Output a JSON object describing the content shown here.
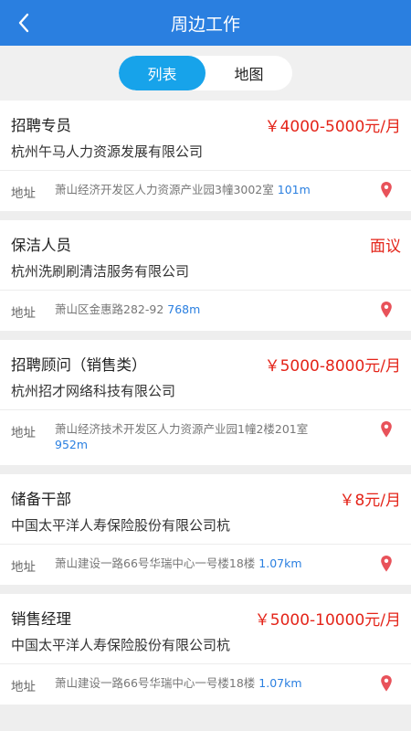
{
  "header": {
    "title": "周边工作",
    "back_icon": "chevron-left-icon"
  },
  "tabs": [
    {
      "label": "列表",
      "active": true
    },
    {
      "label": "地图",
      "active": false
    }
  ],
  "address_label": "地址",
  "jobs": [
    {
      "title": "招聘专员",
      "salary": "￥4000-5000元/月",
      "company": "杭州午马人力资源发展有限公司",
      "address": "萧山经济开发区人力资源产业园3幢3002室",
      "distance": "101m"
    },
    {
      "title": "保洁人员",
      "salary": "面议",
      "company": "杭州洗刷刷清洁服务有限公司",
      "address": "萧山区金惠路282-92",
      "distance": "768m"
    },
    {
      "title": "招聘顾问（销售类）",
      "salary": "￥5000-8000元/月",
      "company": "杭州招才网络科技有限公司",
      "address": "萧山经济技术开发区人力资源产业园1幢2楼201室",
      "distance": "952m"
    },
    {
      "title": "储备干部",
      "salary": "￥8元/月",
      "company": "中国太平洋人寿保险股份有限公司杭",
      "address": "萧山建设一路66号华瑞中心一号楼18楼",
      "distance": "1.07km"
    },
    {
      "title": "销售经理",
      "salary": "￥5000-10000元/月",
      "company": "中国太平洋人寿保险股份有限公司杭",
      "address": "萧山建设一路66号华瑞中心一号楼18楼",
      "distance": "1.07km"
    }
  ],
  "colors": {
    "header_bg": "#2a7fe0",
    "tab_active": "#17a3ea",
    "salary": "#e42419",
    "distance": "#2a7fe0",
    "pin": "#e8525a"
  }
}
